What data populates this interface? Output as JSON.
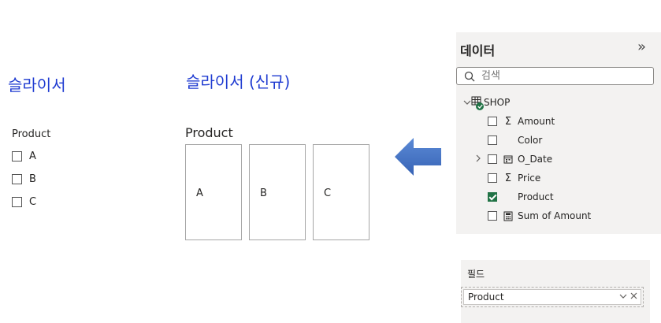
{
  "classic_slicer": {
    "title": "슬라이서",
    "field_header": "Product",
    "items": [
      "A",
      "B",
      "C"
    ]
  },
  "new_slicer": {
    "title": "슬라이서 (신규)",
    "field_header": "Product",
    "tiles": [
      "A",
      "B",
      "C"
    ]
  },
  "data_pane": {
    "title": "데이터",
    "collapse_glyph": "»",
    "search_placeholder": "검색",
    "table_name": "SHOP",
    "fields": [
      {
        "label": "Amount",
        "icon": "sigma-icon",
        "checked": false
      },
      {
        "label": "Color",
        "icon": "none",
        "checked": false
      },
      {
        "label": "O_Date",
        "icon": "calendar-icon",
        "checked": false
      },
      {
        "label": "Price",
        "icon": "sigma-icon",
        "checked": false
      },
      {
        "label": "Product",
        "icon": "none",
        "checked": true
      },
      {
        "label": "Sum of Amount",
        "icon": "calculator-icon",
        "checked": false
      }
    ]
  },
  "fields_well": {
    "title": "필드",
    "value": "Product",
    "actions": "∨ ×"
  },
  "colors": {
    "title_blue": "#1f3bd1",
    "arrow_blue": "#4472c4",
    "check_green": "#217346",
    "pane_bg": "#f3f2f1"
  }
}
